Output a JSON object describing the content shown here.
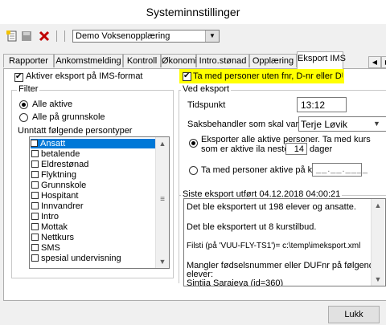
{
  "window": {
    "title": "Systeminnstillinger"
  },
  "toolbar": {
    "school_select": "Demo Voksenopplæring"
  },
  "tabs": [
    {
      "label": "Rapporter"
    },
    {
      "label": "Ankomstmelding"
    },
    {
      "label": "Kontroll"
    },
    {
      "label": "Økonomi"
    },
    {
      "label": "Intro.stønad"
    },
    {
      "label": "Opplæring"
    },
    {
      "label": "Eksport IMS",
      "active": true
    }
  ],
  "left": {
    "activate_label": "Aktiver eksport på IMS-format",
    "activate_checked": true,
    "filter_legend": "Filter",
    "radio_all_active": "Alle aktive",
    "radio_all_grunnskole": "Alle på grunnskole",
    "exclude_label": "Unntatt følgende persontyper",
    "person_types": [
      "Ansatt",
      "betalende",
      "Eldrestønad",
      "Flyktning",
      "Grunnskole",
      "Hospitant",
      "Innvandrer",
      "Intro",
      "Mottak",
      "Nettkurs",
      "SMS",
      "spesial undervisning"
    ],
    "selected_index": 0
  },
  "right": {
    "include_no_id_label": "Ta med personer uten fnr, D-nr eller DUF-nr",
    "include_no_id_checked": true,
    "highlight_color": "#ffff00",
    "export_legend": "Ved eksport",
    "time_label": "Tidspunkt",
    "time_value": "13:12",
    "handler_label": "Saksbehandler som skal varsles",
    "handler_value": "Terje Løvik",
    "radio_export_all_line1": "Eksporter alle aktive personer. Ta med kurs",
    "radio_export_all_line2": "som er aktive ila neste",
    "days_value": "14",
    "days_label": "dager",
    "radio_active_on_course": "Ta med personer aktive på kurs",
    "course_date_placeholder": "__.__.____",
    "last_export_legend": "Siste eksport utført 04.12.2018 04:00:21",
    "log_lines": [
      "Det ble eksportert ut 198 elever og ansatte.",
      "Det ble eksportert ut 8 kurstilbud.",
      "Filsti (på 'VUU-FLY-TS1')= c:\\temp\\imeksport.xml",
      "Mangler fødselsnummer eller DUFnr på følgende",
      "elever:",
      "Sintija Sarajeva (id=360)"
    ]
  },
  "footer": {
    "close_label": "Lukk"
  },
  "colors": {
    "selection": "#0078d7",
    "panel_bg": "#ffffff",
    "window_bg": "#f0f0f0"
  }
}
